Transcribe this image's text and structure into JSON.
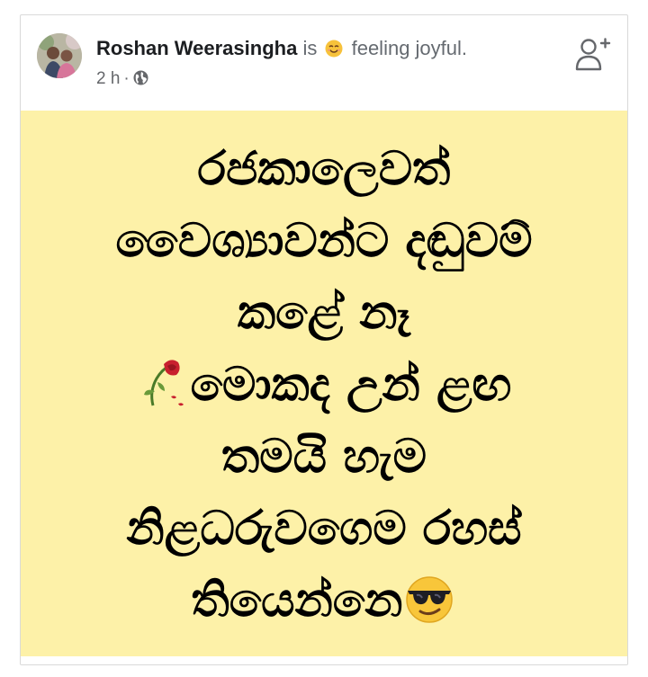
{
  "post": {
    "author": "Roshan Weerasingha",
    "activity_prefix": "is",
    "feeling_icon": "smiling-face-emoji",
    "feeling_text": "feeling joyful.",
    "time": "2 h",
    "separator": "·",
    "audience_icon": "globe-icon",
    "add_friend_icon": "add-friend-icon",
    "background_color": "#fdf1a8",
    "text_lines": [
      {
        "text": "රජකාලෙවත්"
      },
      {
        "text": "වෛශ්‍යාවන්ට දඬුවම්"
      },
      {
        "text": "කළේ නෑ"
      },
      {
        "text": "මොකද උන් ළඟ",
        "lead_icon": "wilted-rose-emoji"
      },
      {
        "text": "තමයි හැම"
      },
      {
        "text": "නිළධරුවගෙම රහස්"
      },
      {
        "text": "තියෙන්නෙ",
        "trail_icon": "sunglasses-face-emoji"
      }
    ]
  }
}
